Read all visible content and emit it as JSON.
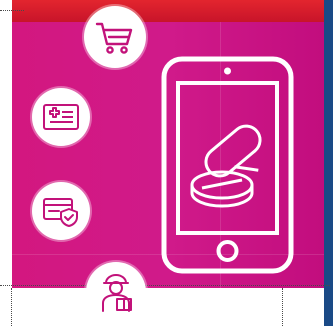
{
  "colors": {
    "panel": "#d3177f",
    "top_bar": "#e3252e",
    "right_edge": "#1a4a86",
    "icon_stroke": "#c2127a",
    "phone_stroke": "#ffffff"
  },
  "icons": [
    "shopping-cart-icon",
    "prescription-card-icon",
    "insurance-card-shield-icon",
    "delivery-person-icon",
    "pills-icon"
  ]
}
